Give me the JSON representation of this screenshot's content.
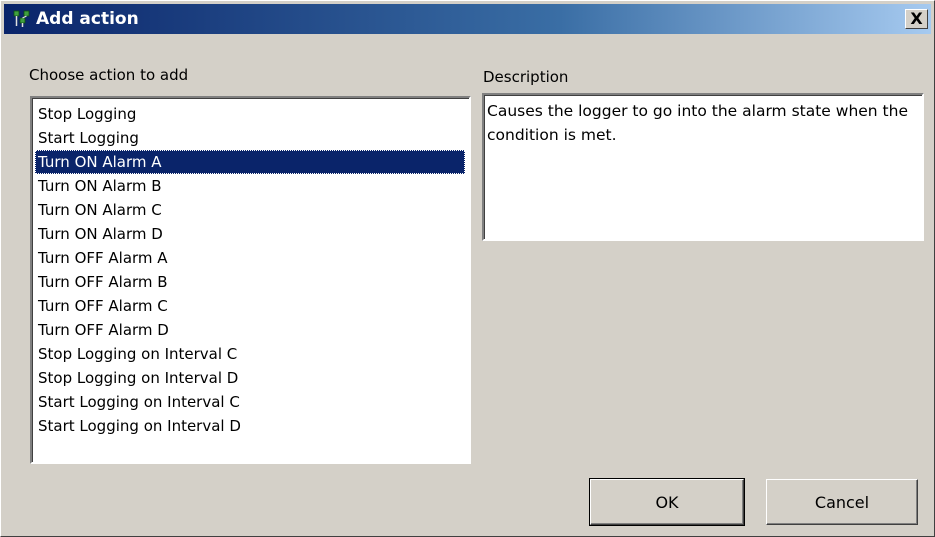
{
  "window": {
    "title": "Add action",
    "close_symbol": "X",
    "colors": {
      "titlebar_start": "#0a246a",
      "titlebar_end": "#a6caf0",
      "face": "#d4d0c8",
      "selection": "#0a246a"
    }
  },
  "actions_list": {
    "label": "Choose action to add",
    "selected_index": 2,
    "items": [
      "Stop Logging",
      "Start Logging",
      "Turn ON Alarm A",
      "Turn ON Alarm B",
      "Turn ON Alarm C",
      "Turn ON Alarm D",
      "Turn OFF Alarm A",
      "Turn OFF Alarm B",
      "Turn OFF Alarm C",
      "Turn OFF Alarm D",
      "Stop Logging on Interval C",
      "Stop Logging on Interval D",
      "Start Logging on Interval C",
      "Start Logging on Interval D"
    ]
  },
  "description": {
    "label": "Description",
    "text": "Causes the logger to go into the alarm state when the condition is met."
  },
  "buttons": {
    "ok": "OK",
    "cancel": "Cancel"
  },
  "icons": {
    "app": "app-icon",
    "close": "close-icon"
  }
}
